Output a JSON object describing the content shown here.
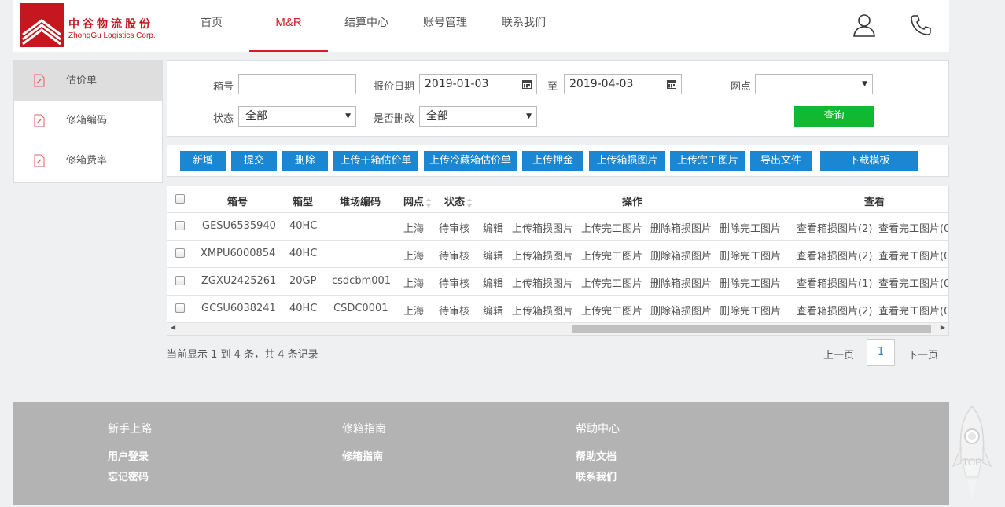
{
  "brand": {
    "name_cn": "中谷物流股份",
    "name_en": "ZhongGu Logistics Corp."
  },
  "nav": {
    "items": [
      {
        "label": "首页"
      },
      {
        "label": "M&R",
        "active": true
      },
      {
        "label": "结算中心"
      },
      {
        "label": "账号管理"
      },
      {
        "label": "联系我们"
      }
    ],
    "icons": [
      "user-icon",
      "phone-icon"
    ]
  },
  "sidebar": {
    "items": [
      {
        "label": "估价单",
        "active": true
      },
      {
        "label": "修箱编码"
      },
      {
        "label": "修箱费率"
      }
    ]
  },
  "filter": {
    "box_no_label": "箱号",
    "box_no_value": "",
    "date_label": "报价日期",
    "date_from": "2019-01-03",
    "date_sep": "至",
    "date_to": "2019-04-03",
    "branch_label": "网点",
    "branch_value": "",
    "status_label": "状态",
    "status_value": "全部",
    "deleted_label": "是否删改",
    "deleted_value": "全部",
    "query_label": "查询"
  },
  "toolbar": {
    "buttons": [
      "新增",
      "提交",
      "删除",
      "上传干箱估价单",
      "上传冷藏箱估价单",
      "上传押金",
      "上传箱损图片",
      "上传完工图片",
      "导出文件",
      "下载模板"
    ]
  },
  "table": {
    "headers": {
      "box_no": "箱号",
      "box_type": "箱型",
      "yard_code": "堆场编码",
      "branch": "网点",
      "status": "状态",
      "actions": "操作",
      "view": "查看"
    },
    "rows": [
      {
        "box_no": "GESU6535940",
        "box_type": "40HC",
        "yard_code": "",
        "branch": "上海",
        "status": "待审核",
        "view_damage": "查看箱损图片(2)",
        "view_done": "查看完工图片(0"
      },
      {
        "box_no": "XMPU6000854",
        "box_type": "40HC",
        "yard_code": "",
        "branch": "上海",
        "status": "待审核",
        "view_damage": "查看箱损图片(2)",
        "view_done": "查看完工图片(0"
      },
      {
        "box_no": "ZGXU2425261",
        "box_type": "20GP",
        "yard_code": "csdcbm001",
        "branch": "上海",
        "status": "待审核",
        "view_damage": "查看箱损图片(1)",
        "view_done": "查看完工图片(0"
      },
      {
        "box_no": "GCSU6038241",
        "box_type": "40HC",
        "yard_code": "CSDC0001",
        "branch": "上海",
        "status": "待审核",
        "view_damage": "查看箱损图片(2)",
        "view_done": "查看完工图片(0"
      }
    ],
    "row_actions": [
      "编辑",
      "上传箱损图片",
      "上传完工图片",
      "删除箱损图片",
      "删除完工图片"
    ]
  },
  "pagination": {
    "info": "当前显示 1 到 4 条，共 4 条记录",
    "prev": "上一页",
    "current": "1",
    "next": "下一页"
  },
  "footer": {
    "columns": [
      {
        "title": "新手上路",
        "links": [
          "用户登录",
          "忘记密码"
        ]
      },
      {
        "title": "修箱指南",
        "links": [
          "修箱指南"
        ]
      },
      {
        "title": "帮助中心",
        "links": [
          "帮助文档",
          "联系我们"
        ]
      }
    ]
  },
  "back_to_top": "TOP",
  "colors": {
    "brand_red": "#d21f26",
    "primary_blue": "#1b86d1",
    "query_green": "#0fba31",
    "link_green": "#5aae2b",
    "footer_gray": "#b3b3b3"
  }
}
